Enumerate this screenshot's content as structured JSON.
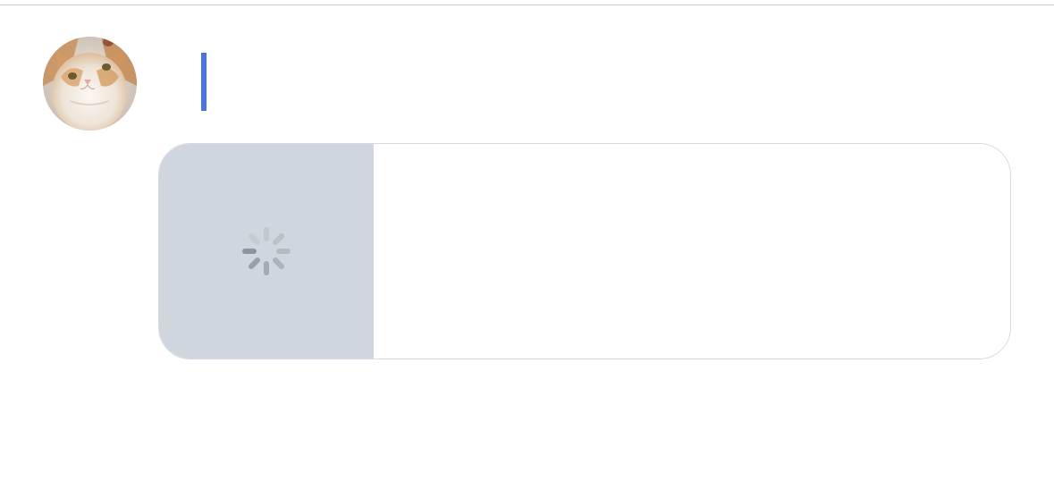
{
  "composer": {
    "text": ""
  },
  "link_preview": {
    "status": "loading"
  },
  "colors": {
    "caret": "#4a72e8",
    "thumb_background": "#cfd6de",
    "card_border": "#d6dadf"
  },
  "icons": {
    "avatar": "cat-avatar",
    "spinner": "spinner-icon"
  }
}
